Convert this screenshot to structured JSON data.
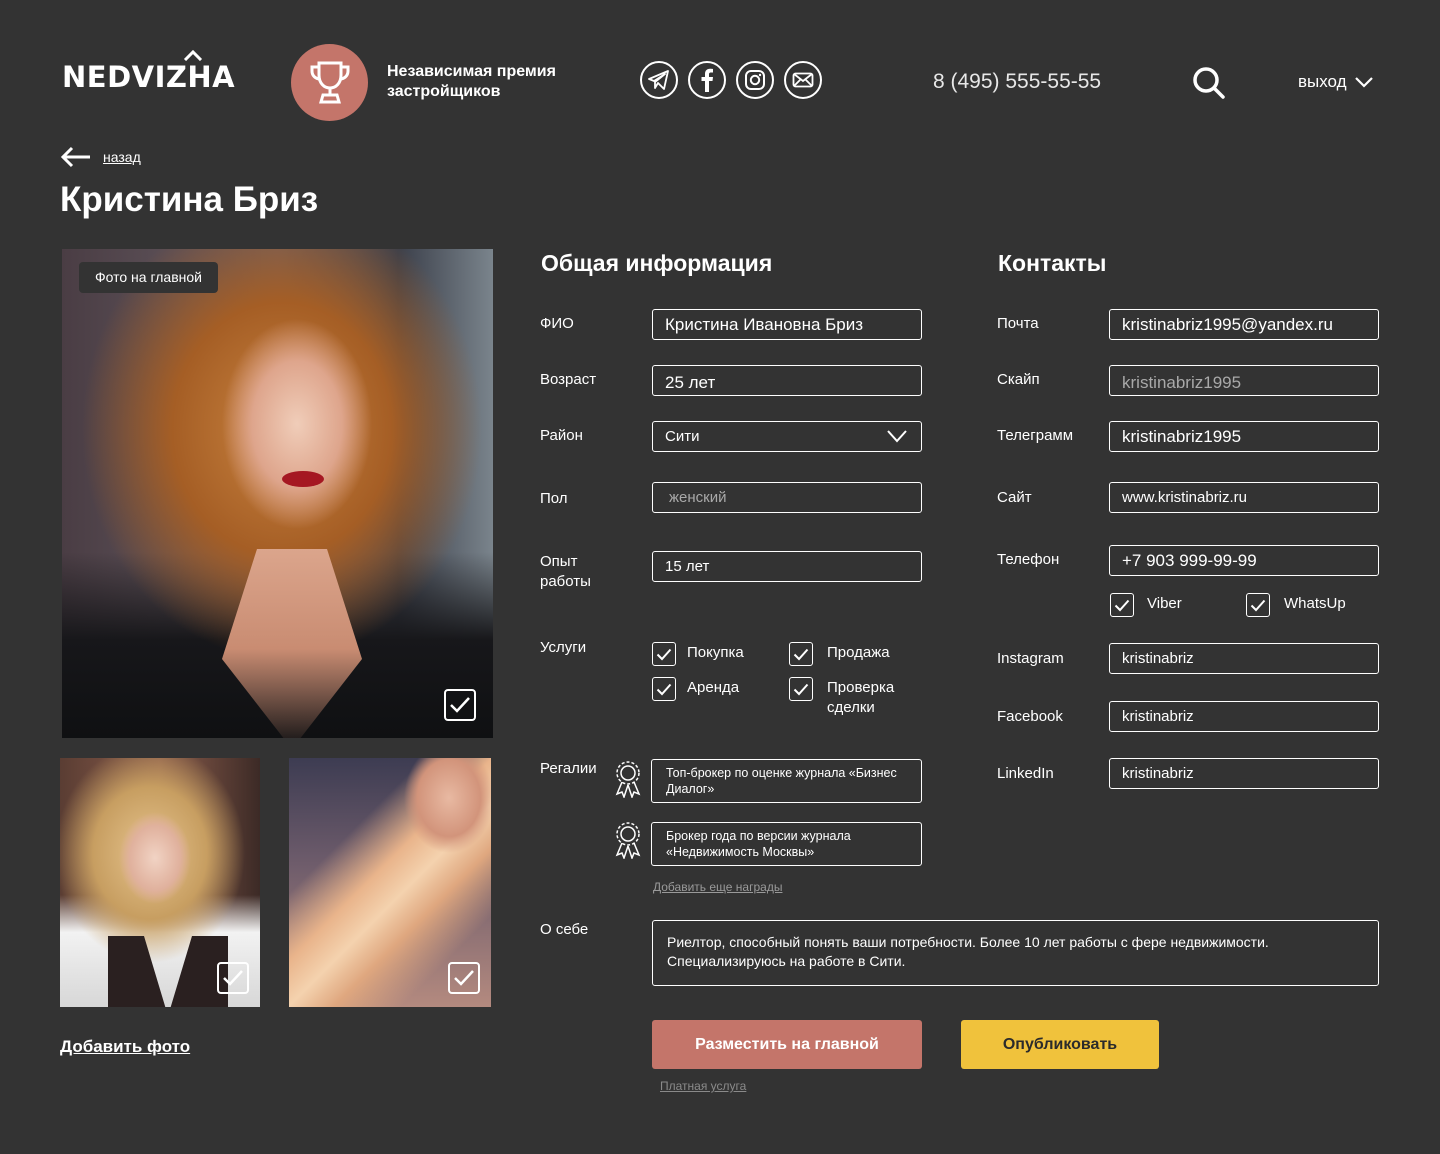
{
  "header": {
    "logo": "NEDVIZHA",
    "award_text": "Независимая премия застройщиков",
    "phone": "8 (495) 555-55-55",
    "logout": "выход"
  },
  "nav": {
    "back": "назад"
  },
  "profile": {
    "name": "Кристина Бриз"
  },
  "photos": {
    "main_badge": "Фото на главной",
    "add_photo": "Добавить фото"
  },
  "general": {
    "title": "Общая информация",
    "fio_label": "ФИО",
    "fio_value": "Кристина Ивановна Бриз",
    "age_label": "Возраст",
    "age_value": "25 лет",
    "district_label": "Район",
    "district_value": "Сити",
    "gender_label": "Пол",
    "gender_placeholder": "женский",
    "experience_label_1": "Опыт",
    "experience_label_2": "работы",
    "experience_value": "15 лет",
    "services_label": "Услуги",
    "services": [
      {
        "label": "Покупка",
        "checked": true
      },
      {
        "label": "Продажа",
        "checked": true
      },
      {
        "label": "Аренда",
        "checked": true
      },
      {
        "label": "Проверка сделки",
        "checked": true
      }
    ],
    "regalia_label": "Регалии",
    "regalia": [
      "Топ-брокер по оценке журнала «Бизнес Диалог»",
      "Брокер года по версии журнала «Недвижимость Москвы»"
    ],
    "add_award": "Добавить еще награды",
    "about_label": "О себе",
    "about_text": "Риелтор, способный понять ваши потребности.  Более 10 лет работы с фере недвижимости. Специализируюсь на работе в Сити."
  },
  "contacts": {
    "title": "Контакты",
    "email_label": "Почта",
    "email_value": "kristinabriz1995@yandex.ru",
    "skype_label": "Скайп",
    "skype_placeholder": "kristinabriz1995",
    "telegram_label": "Телеграмм",
    "telegram_value": "kristinabriz1995",
    "site_label": "Сайт",
    "site_value": "www.kristinabriz.ru",
    "phone_label": "Телефон",
    "phone_value": "+7 903 999-99-99",
    "viber": "Viber",
    "whatsapp": "WhatsUp",
    "instagram_label": "Instagram",
    "instagram_value": "kristinabriz",
    "facebook_label": "Facebook",
    "facebook_value": "kristinabriz",
    "linkedin_label": "LinkedIn",
    "linkedin_value": "kristinabriz"
  },
  "actions": {
    "promote": "Разместить на главной",
    "publish": "Опубликовать",
    "paid_service": "Платная услуга"
  },
  "colors": {
    "background": "#333333",
    "accent_red": "#c4756a",
    "accent_yellow": "#f0c23c"
  }
}
